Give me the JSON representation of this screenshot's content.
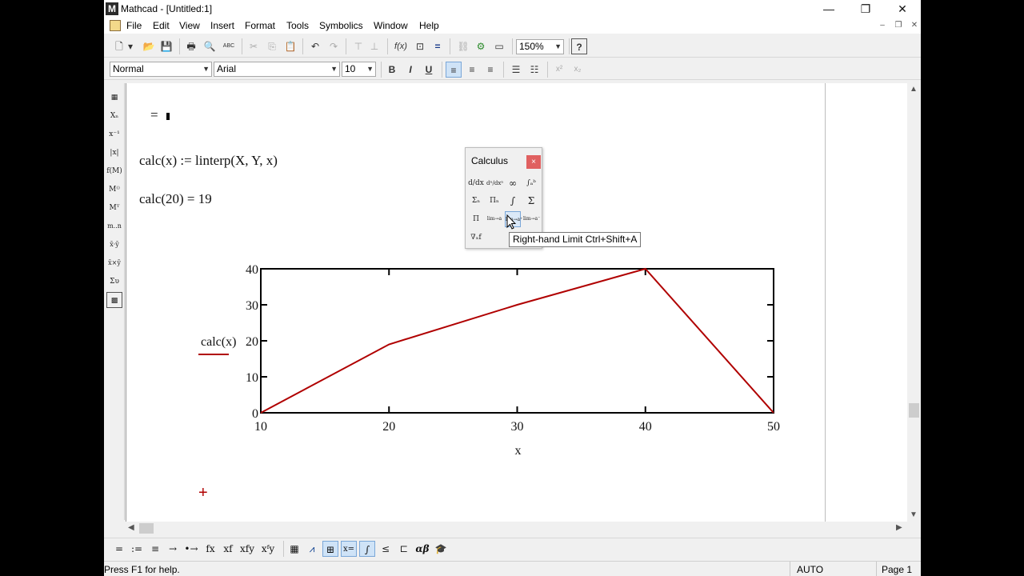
{
  "window": {
    "app_icon_letter": "M",
    "title": "Mathcad - [Untitled:1]",
    "minimize": "—",
    "maximize": "❐",
    "close": "✕"
  },
  "menu": [
    {
      "id": "file",
      "label": "File"
    },
    {
      "id": "edit",
      "label": "Edit"
    },
    {
      "id": "view",
      "label": "View"
    },
    {
      "id": "insert",
      "label": "Insert"
    },
    {
      "id": "format",
      "label": "Format"
    },
    {
      "id": "tools",
      "label": "Tools"
    },
    {
      "id": "symbolics",
      "label": "Symbolics"
    },
    {
      "id": "window",
      "label": "Window"
    },
    {
      "id": "help",
      "label": "Help"
    }
  ],
  "mdi_controls": {
    "minimize": "–",
    "restore": "❐",
    "close": "✕"
  },
  "standard_toolbar": {
    "buttons": [
      {
        "icon": "new-document-icon",
        "glyph": "🗋"
      },
      {
        "icon": "new-dropdown-icon",
        "glyph": "▾"
      },
      {
        "icon": "open-icon",
        "glyph": "📂"
      },
      {
        "icon": "save-icon",
        "glyph": "💾"
      },
      {
        "icon": "print-icon",
        "glyph": "🖶"
      },
      {
        "icon": "print-preview-icon",
        "glyph": "🔍"
      },
      {
        "icon": "spell-check-icon",
        "glyph": "ABC"
      },
      {
        "icon": "cut-icon",
        "glyph": "✂"
      },
      {
        "icon": "copy-icon",
        "glyph": "⎘"
      },
      {
        "icon": "paste-icon",
        "glyph": "📋"
      },
      {
        "icon": "undo-icon",
        "glyph": "↶"
      },
      {
        "icon": "redo-icon",
        "glyph": "↷"
      },
      {
        "icon": "align-across-icon",
        "glyph": "⊤"
      },
      {
        "icon": "align-down-icon",
        "glyph": "⊥"
      },
      {
        "icon": "insert-function-icon",
        "glyph": "f(x)"
      },
      {
        "icon": "insert-unit-icon",
        "glyph": "⊡"
      },
      {
        "icon": "calculate-icon",
        "glyph": "="
      },
      {
        "icon": "insert-hyperlink-icon",
        "glyph": "⛓"
      },
      {
        "icon": "component-wizard-icon",
        "glyph": "⚙"
      },
      {
        "icon": "resource-center-icon",
        "glyph": "▭"
      },
      {
        "icon": "help-icon",
        "glyph": "?"
      }
    ],
    "zoom": "150%"
  },
  "format_toolbar": {
    "style": "Normal",
    "font": "Arial",
    "size": "10",
    "bold": "B",
    "italic": "I",
    "underline": "U",
    "align_left": "≡",
    "align_center": "≡",
    "align_right": "≡",
    "bullets": "☰",
    "numbering": "☷",
    "superscript": "x²",
    "subscript": "x₂"
  },
  "math_palette_toolbar": [
    {
      "icon": "calculator-icon",
      "glyph": "▦"
    },
    {
      "icon": "subscript-icon",
      "glyph": "Xₙ"
    },
    {
      "icon": "inverse-icon",
      "glyph": "x⁻¹"
    },
    {
      "icon": "absolute-value-icon",
      "glyph": "|x|"
    },
    {
      "icon": "function-icon",
      "glyph": "f(M)"
    },
    {
      "icon": "superscript-matrix-icon",
      "glyph": "M⁽⁾"
    },
    {
      "icon": "transpose-icon",
      "glyph": "Mᵀ"
    },
    {
      "icon": "range-variable-icon",
      "glyph": "m..n"
    },
    {
      "icon": "dot-product-icon",
      "glyph": "x̄·ȳ"
    },
    {
      "icon": "cross-product-icon",
      "glyph": "x̄×ȳ"
    },
    {
      "icon": "vector-sum-icon",
      "glyph": "Συ"
    },
    {
      "icon": "picture-icon",
      "glyph": "▩"
    }
  ],
  "worksheet": {
    "eval_line": "= ",
    "definition": "calc(x) := linterp(X, Y, x)",
    "evaluation": "calc(20) = 19"
  },
  "chart_data": {
    "type": "line",
    "xlabel": "x",
    "ylabel": "calc(x)",
    "xlim": [
      10,
      50
    ],
    "ylim": [
      0,
      40
    ],
    "x_ticks": [
      "10",
      "20",
      "30",
      "40",
      "50"
    ],
    "y_ticks": [
      "0",
      "10",
      "20",
      "30",
      "40"
    ],
    "series": [
      {
        "x": [
          10,
          20,
          30,
          40,
          50
        ],
        "values": [
          0,
          19,
          30,
          40,
          0
        ],
        "color": "#b00000"
      }
    ]
  },
  "calculus_palette": {
    "title": "Calculus",
    "close": "×",
    "buttons": [
      {
        "icon": "derivative-icon",
        "glyph": "d/dx"
      },
      {
        "icon": "nth-derivative-icon",
        "glyph": "dⁿ/dxⁿ"
      },
      {
        "icon": "infinity-icon",
        "glyph": "∞"
      },
      {
        "icon": "definite-integral-icon",
        "glyph": "∫ₐᵇ"
      },
      {
        "icon": "summation-icon",
        "glyph": "Σₙ"
      },
      {
        "icon": "product-icon",
        "glyph": "Πₙ"
      },
      {
        "icon": "indefinite-integral-icon",
        "glyph": "∫"
      },
      {
        "icon": "range-sum-icon",
        "glyph": "Σ"
      },
      {
        "icon": "range-product-icon",
        "glyph": "Π"
      },
      {
        "icon": "limit-icon",
        "glyph": "lim→a"
      },
      {
        "icon": "right-limit-icon",
        "glyph": "lim→a⁺"
      },
      {
        "icon": "left-limit-icon",
        "glyph": "lim→a⁻"
      },
      {
        "icon": "gradient-icon",
        "glyph": "∇ₓf"
      }
    ],
    "tooltip": "Right-hand Limit Ctrl+Shift+A"
  },
  "bottom_toolbar": {
    "left": [
      {
        "icon": "evaluate-icon",
        "glyph": "="
      },
      {
        "icon": "define-icon",
        "glyph": ":="
      },
      {
        "icon": "global-define-icon",
        "glyph": "≡"
      },
      {
        "icon": "symbolic-eval-icon",
        "glyph": "→"
      },
      {
        "icon": "keyword-symbolic-icon",
        "glyph": "•→"
      },
      {
        "icon": "prefix-icon",
        "glyph": "fx"
      },
      {
        "icon": "postfix-icon",
        "glyph": "xf"
      },
      {
        "icon": "infix-icon",
        "glyph": "xfy"
      },
      {
        "icon": "treefix-icon",
        "glyph": "xᶠy"
      }
    ],
    "right": [
      {
        "icon": "calculator-toolbar-icon",
        "glyph": "▦"
      },
      {
        "icon": "graph-toolbar-icon",
        "glyph": "⩘"
      },
      {
        "icon": "matrix-toolbar-icon",
        "glyph": "⊞"
      },
      {
        "icon": "evaluation-toolbar-icon",
        "glyph": "x="
      },
      {
        "icon": "calculus-toolbar-icon",
        "glyph": "∫"
      },
      {
        "icon": "boolean-toolbar-icon",
        "glyph": "≤"
      },
      {
        "icon": "programming-toolbar-icon",
        "glyph": "⊏"
      },
      {
        "icon": "greek-toolbar-icon",
        "glyph": "αβ"
      },
      {
        "icon": "symbolic-toolbar-icon",
        "glyph": "🎓"
      }
    ]
  },
  "status": {
    "help": "Press F1 for help.",
    "mode": "AUTO",
    "page": "Page 1"
  }
}
